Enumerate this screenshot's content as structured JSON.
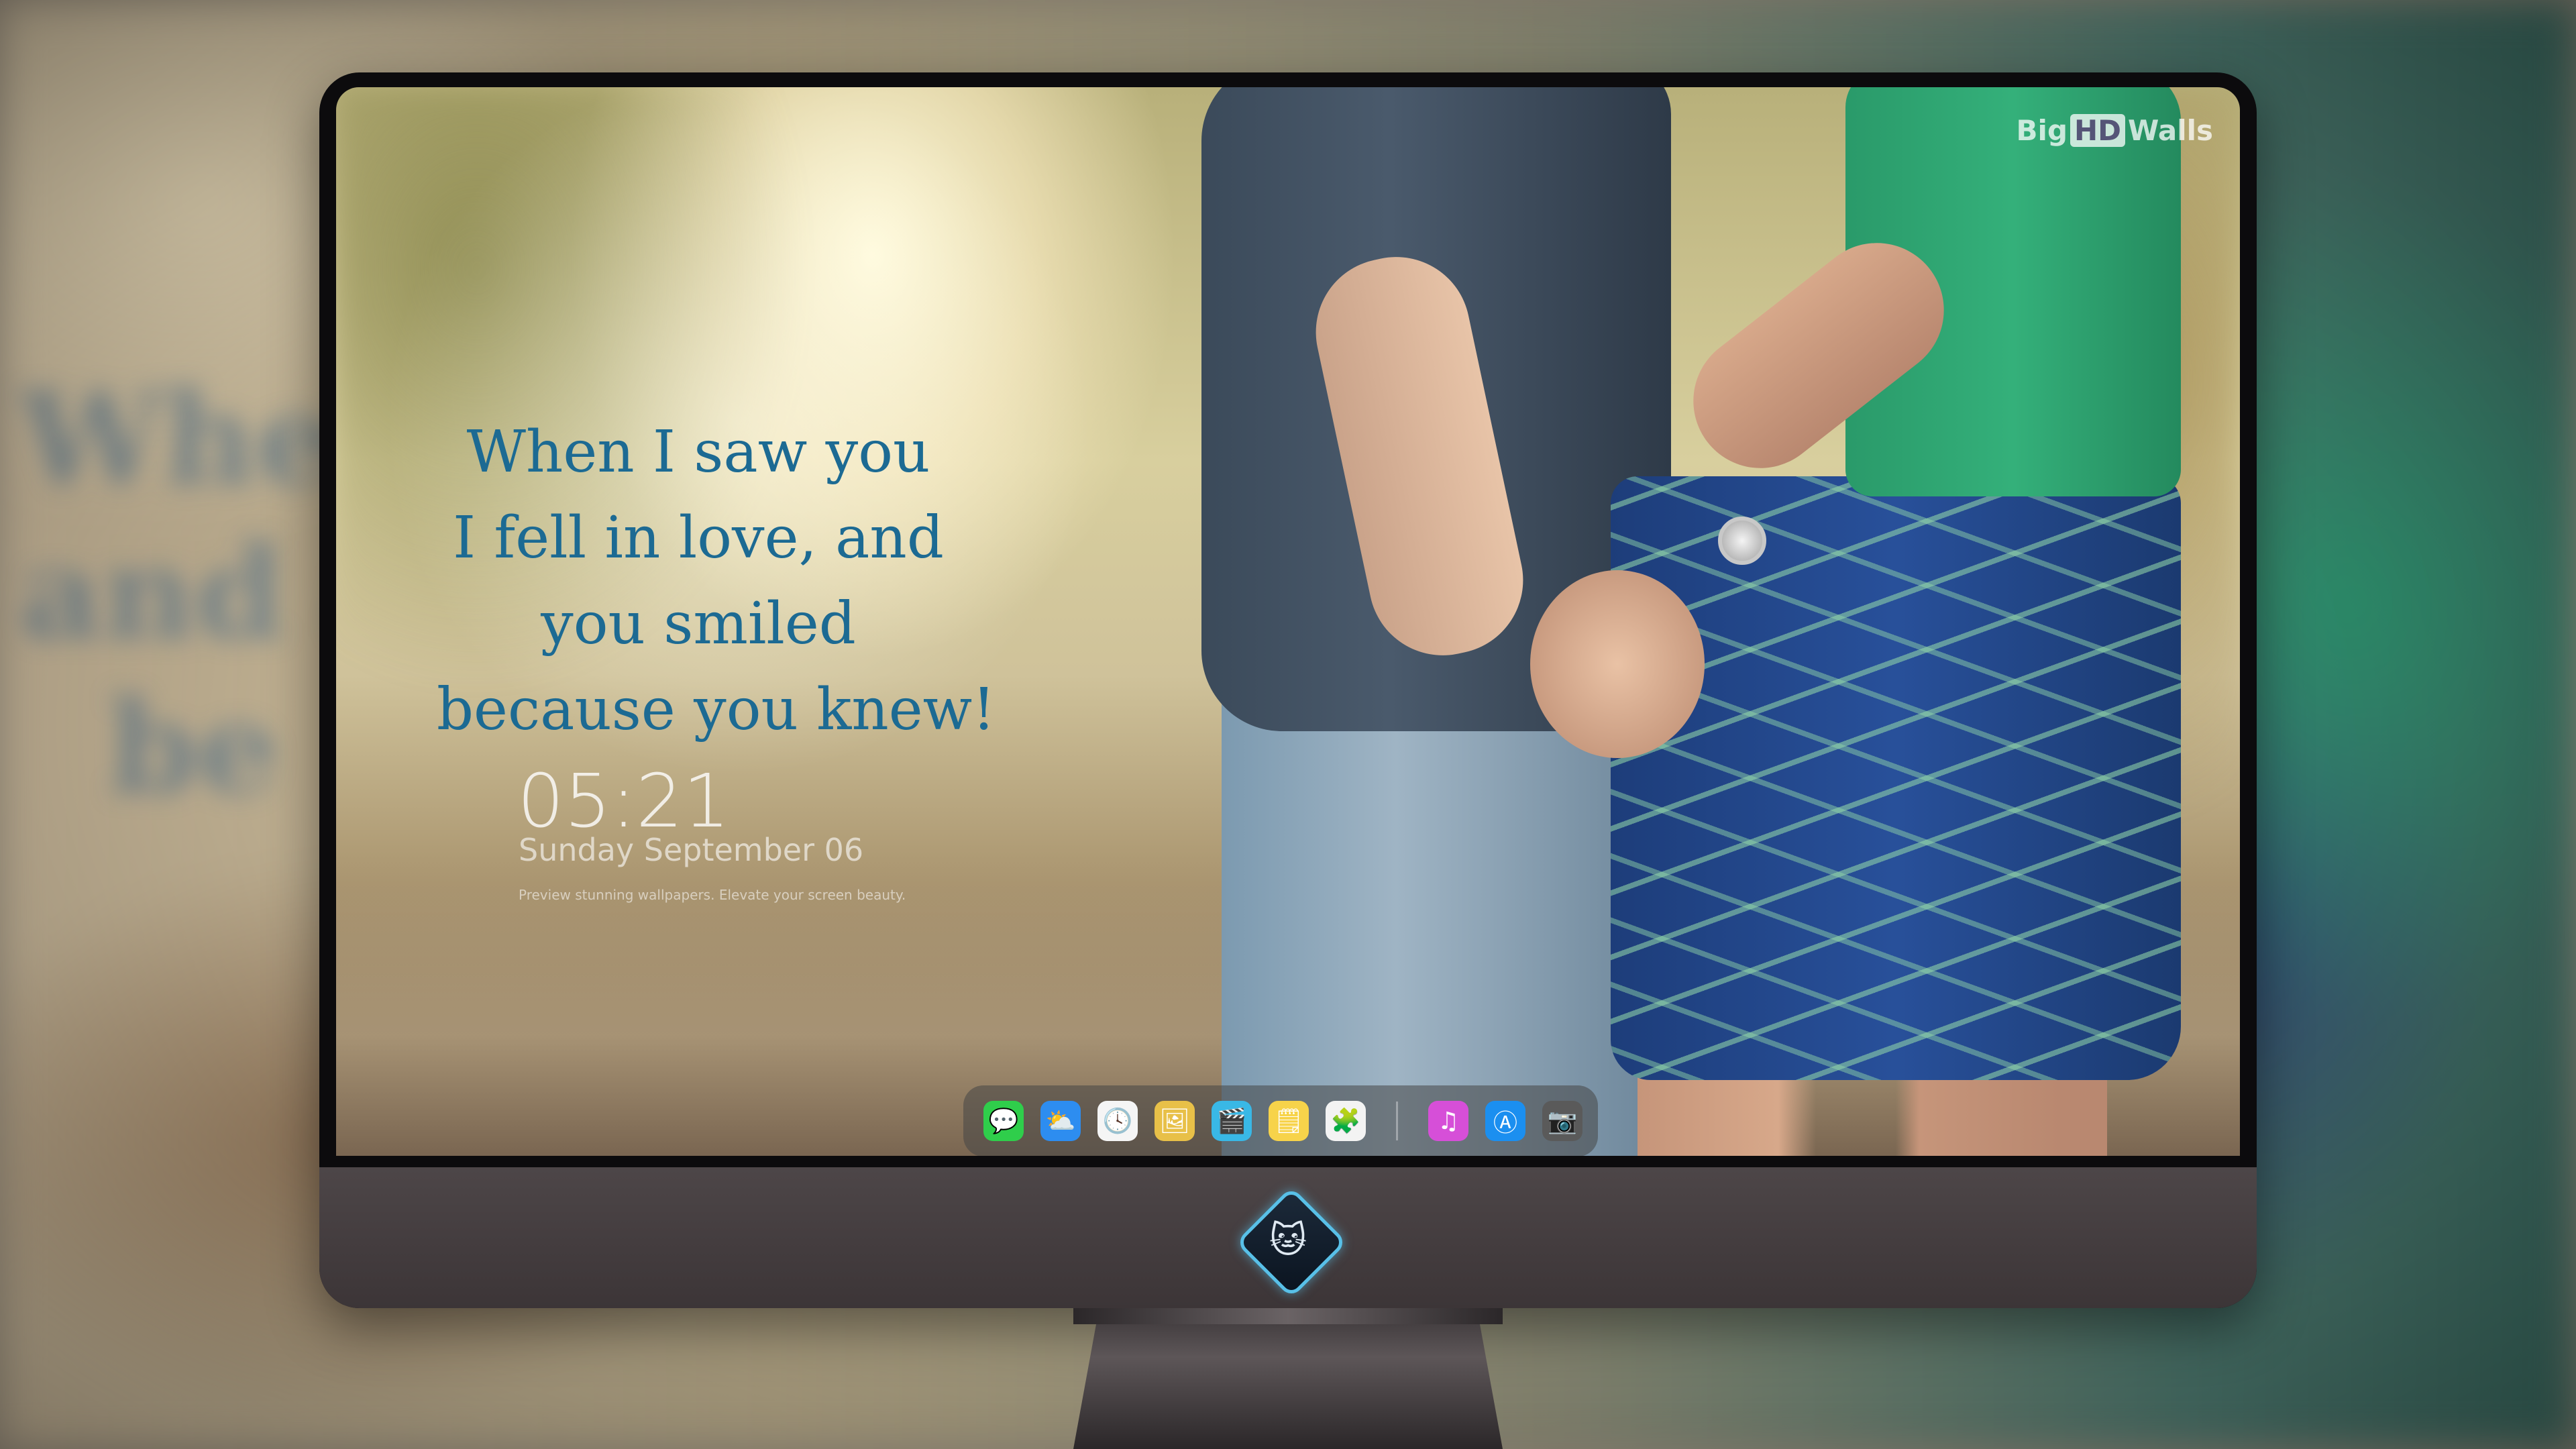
{
  "wallpaper": {
    "quote_lines": [
      "When I saw you",
      "I fell in love, and",
      "you smiled",
      "because you knew!"
    ],
    "watermark": {
      "prefix": "Big",
      "badge": "HD",
      "suffix": "Walls"
    }
  },
  "lockscreen": {
    "time": "05:21",
    "date": "Sunday September  06",
    "tagline": "Preview stunning wallpapers. Elevate your screen beauty."
  },
  "dock": {
    "apps": [
      {
        "name": "Messages",
        "icon": "message-bubble-icon",
        "glyph": "💬",
        "color": "#2fce4b"
      },
      {
        "name": "Weather",
        "icon": "weather-cloud-icon",
        "glyph": "⛅",
        "color": "#2d8df0"
      },
      {
        "name": "Clock",
        "icon": "clock-icon",
        "glyph": "🕓",
        "color": "#f5f5f5"
      },
      {
        "name": "Preview",
        "icon": "preview-icon",
        "glyph": "🖼",
        "color": "#e8c048"
      },
      {
        "name": "Clips",
        "icon": "clapperboard-icon",
        "glyph": "🎬",
        "color": "#39b8e6"
      },
      {
        "name": "Notes",
        "icon": "notes-icon",
        "glyph": "🗒",
        "color": "#f7d34a"
      },
      {
        "name": "Photo Booth",
        "icon": "photo-grid-icon",
        "glyph": "🧩",
        "color": "#f3f3f3"
      },
      {
        "name": "iTunes",
        "icon": "music-note-icon",
        "glyph": "♫",
        "color": "#d64fd8"
      },
      {
        "name": "App Store",
        "icon": "app-store-icon",
        "glyph": "Ⓐ",
        "color": "#1b8ff0"
      },
      {
        "name": "Camera",
        "icon": "camera-icon",
        "glyph": "📷",
        "color": "#5a5a5a"
      }
    ]
  },
  "colors": {
    "quote": "#1c6a93",
    "logo_ring": "#58c0e8"
  }
}
